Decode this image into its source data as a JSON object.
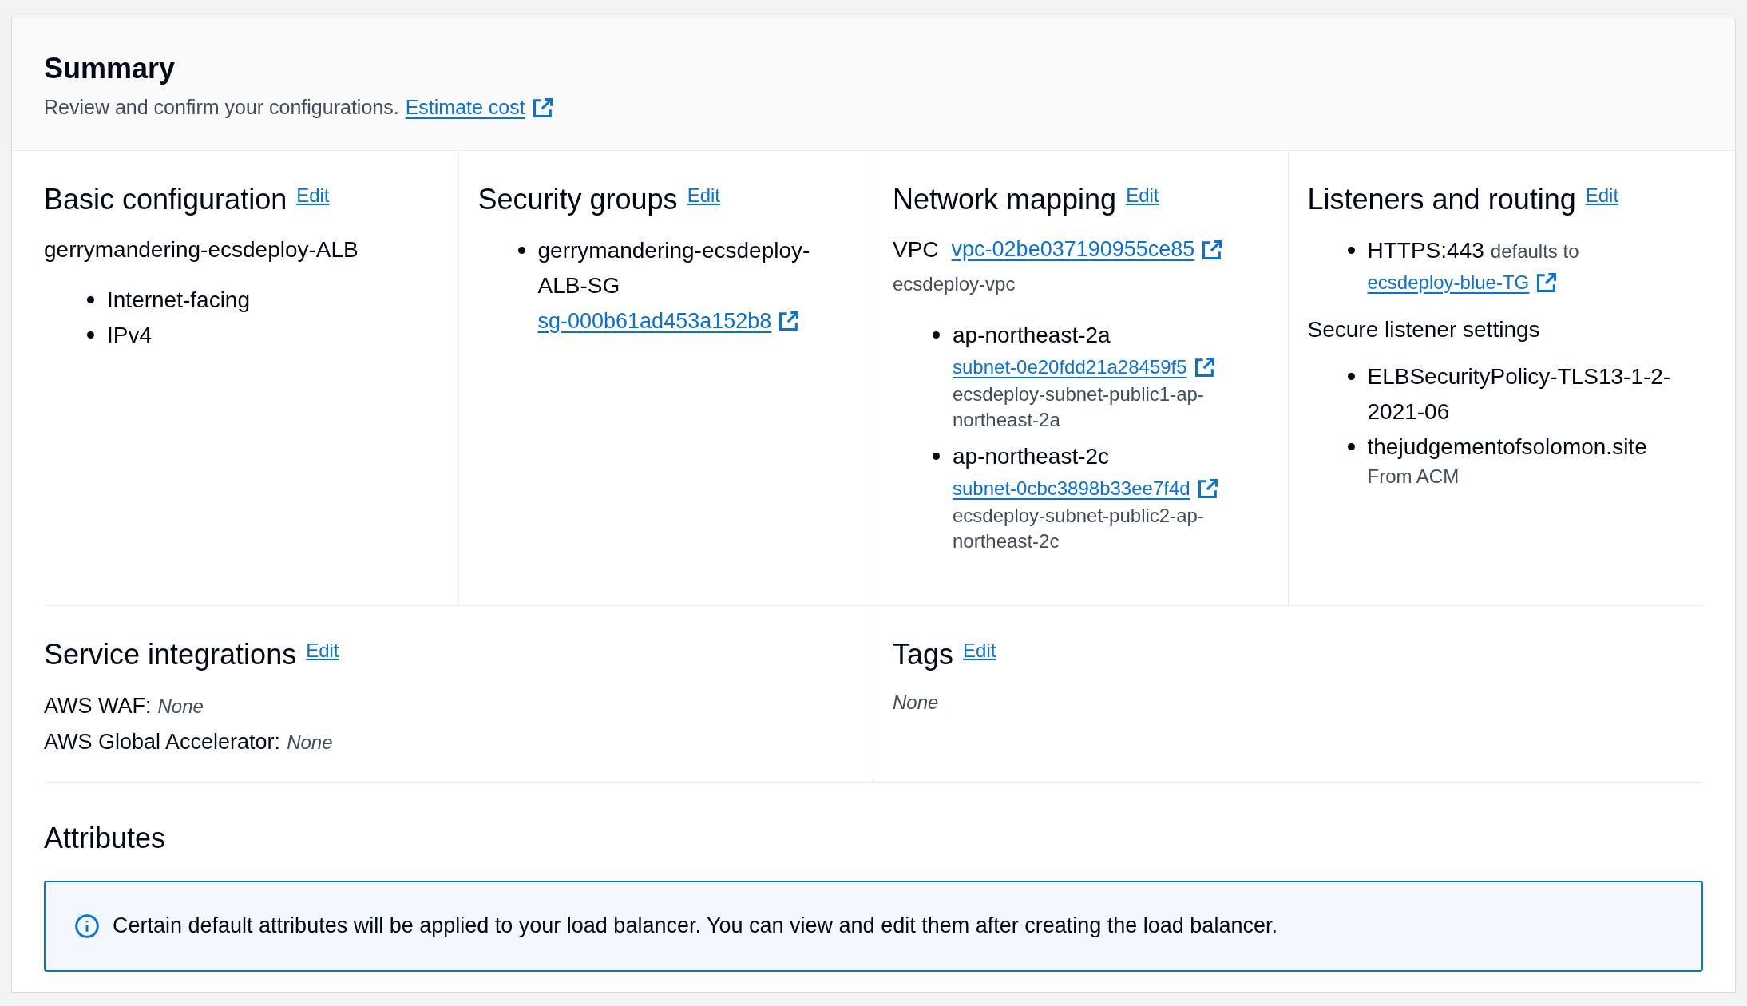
{
  "summary": {
    "title": "Summary",
    "description": "Review and confirm your configurations.",
    "link": "Estimate cost"
  },
  "basic": {
    "title": "Basic configuration",
    "edit": "Edit",
    "name": "gerrymandering-ecsdeploy-ALB",
    "items": [
      "Internet-facing",
      "IPv4"
    ]
  },
  "security_groups": {
    "title": "Security groups",
    "edit": "Edit",
    "items": [
      {
        "name": "gerrymandering-ecsdeploy-ALB-SG",
        "link": "sg-000b61ad453a152b8"
      }
    ]
  },
  "network": {
    "title": "Network mapping",
    "edit": "Edit",
    "vpc_label": "VPC",
    "vpc_link": "vpc-02be037190955ce85",
    "vpc_name": "ecsdeploy-vpc",
    "zones": [
      {
        "zone": "ap-northeast-2a",
        "subnet": "subnet-0e20fdd21a28459f5",
        "subnet_name": "ecsdeploy-subnet-public1-ap-northeast-2a"
      },
      {
        "zone": "ap-northeast-2c",
        "subnet": "subnet-0cbc3898b33ee7f4d",
        "subnet_name": "ecsdeploy-subnet-public2-ap-northeast-2c"
      }
    ]
  },
  "listeners": {
    "title": "Listeners and routing",
    "edit": "Edit",
    "items": [
      {
        "listener": "HTTPS:443",
        "defaults": "defaults to",
        "target": "ecsdeploy-blue-TG"
      }
    ],
    "secure_title": "Secure listener settings",
    "policy": "ELBSecurityPolicy-TLS13-1-2-2021-06",
    "certificate": "thejudgementofsolomon.site",
    "certificate_source": "From ACM"
  },
  "service_integrations": {
    "title": "Service integrations",
    "edit": "Edit",
    "rows": [
      {
        "label": "AWS WAF:",
        "value": "None"
      },
      {
        "label": "AWS Global Accelerator:",
        "value": "None"
      }
    ]
  },
  "tags": {
    "title": "Tags",
    "edit": "Edit",
    "value": "None"
  },
  "attributes": {
    "title": "Attributes",
    "info": "Certain default attributes will be applied to your load balancer. You can view and edit them after creating the load balancer."
  }
}
